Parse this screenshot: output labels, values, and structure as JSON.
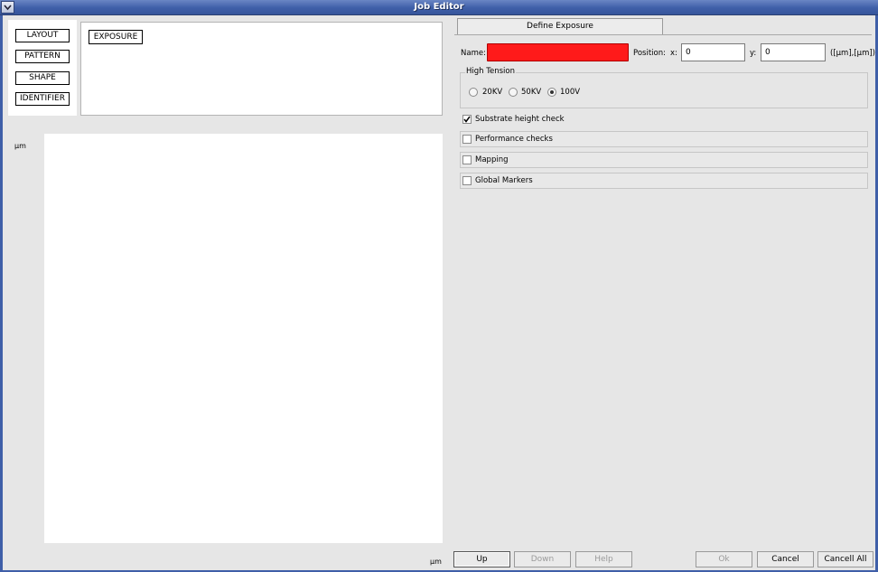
{
  "window": {
    "title": "Job Editor"
  },
  "tree": {
    "buttons": [
      {
        "label": "LAYOUT"
      },
      {
        "label": "PATTERN"
      },
      {
        "label": "SHAPE"
      },
      {
        "label": "IDENTIFIER"
      }
    ],
    "exposure_label": "EXPOSURE"
  },
  "canvas": {
    "y_unit": "µm",
    "x_unit": "µm"
  },
  "tab": {
    "label": "Define Exposure"
  },
  "form": {
    "name_label": "Name:",
    "name_value": "",
    "name_field_color": "#ff1a1a",
    "position_label": "Position:",
    "x_label": "x:",
    "x_value": "0",
    "y_label": "y:",
    "y_value": "0",
    "unit_label": "([µm],[µm])"
  },
  "high_tension": {
    "label": "High Tension",
    "options": [
      {
        "label": "20KV",
        "selected": false
      },
      {
        "label": "50KV",
        "selected": false
      },
      {
        "label": "100V",
        "selected": true
      }
    ]
  },
  "checks": {
    "substrate_height": {
      "label": "Substrate height check",
      "checked": true
    }
  },
  "sections": [
    {
      "label": "Performance checks",
      "checked": false
    },
    {
      "label": "Mapping",
      "checked": false
    },
    {
      "label": "Global Markers",
      "checked": false
    }
  ],
  "footer": {
    "up": "Up",
    "down": "Down",
    "help": "Help",
    "ok": "Ok",
    "cancel": "Cancel",
    "cancel_all": "Cancell All"
  }
}
